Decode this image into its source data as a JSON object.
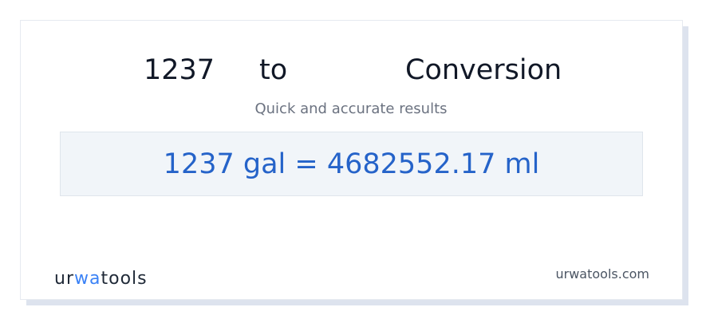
{
  "header": {
    "amount": "1237",
    "connector": "to",
    "title_suffix": "Conversion"
  },
  "subtitle": "Quick and accurate results",
  "result": {
    "text": "1237 gal = 4682552.17 ml"
  },
  "footer": {
    "logo_prefix": "ur",
    "logo_accent": "wa",
    "logo_suffix": "tools",
    "domain": "urwatools.com"
  },
  "colors": {
    "accent": "#2563c9",
    "logo_accent": "#3b82f6"
  }
}
